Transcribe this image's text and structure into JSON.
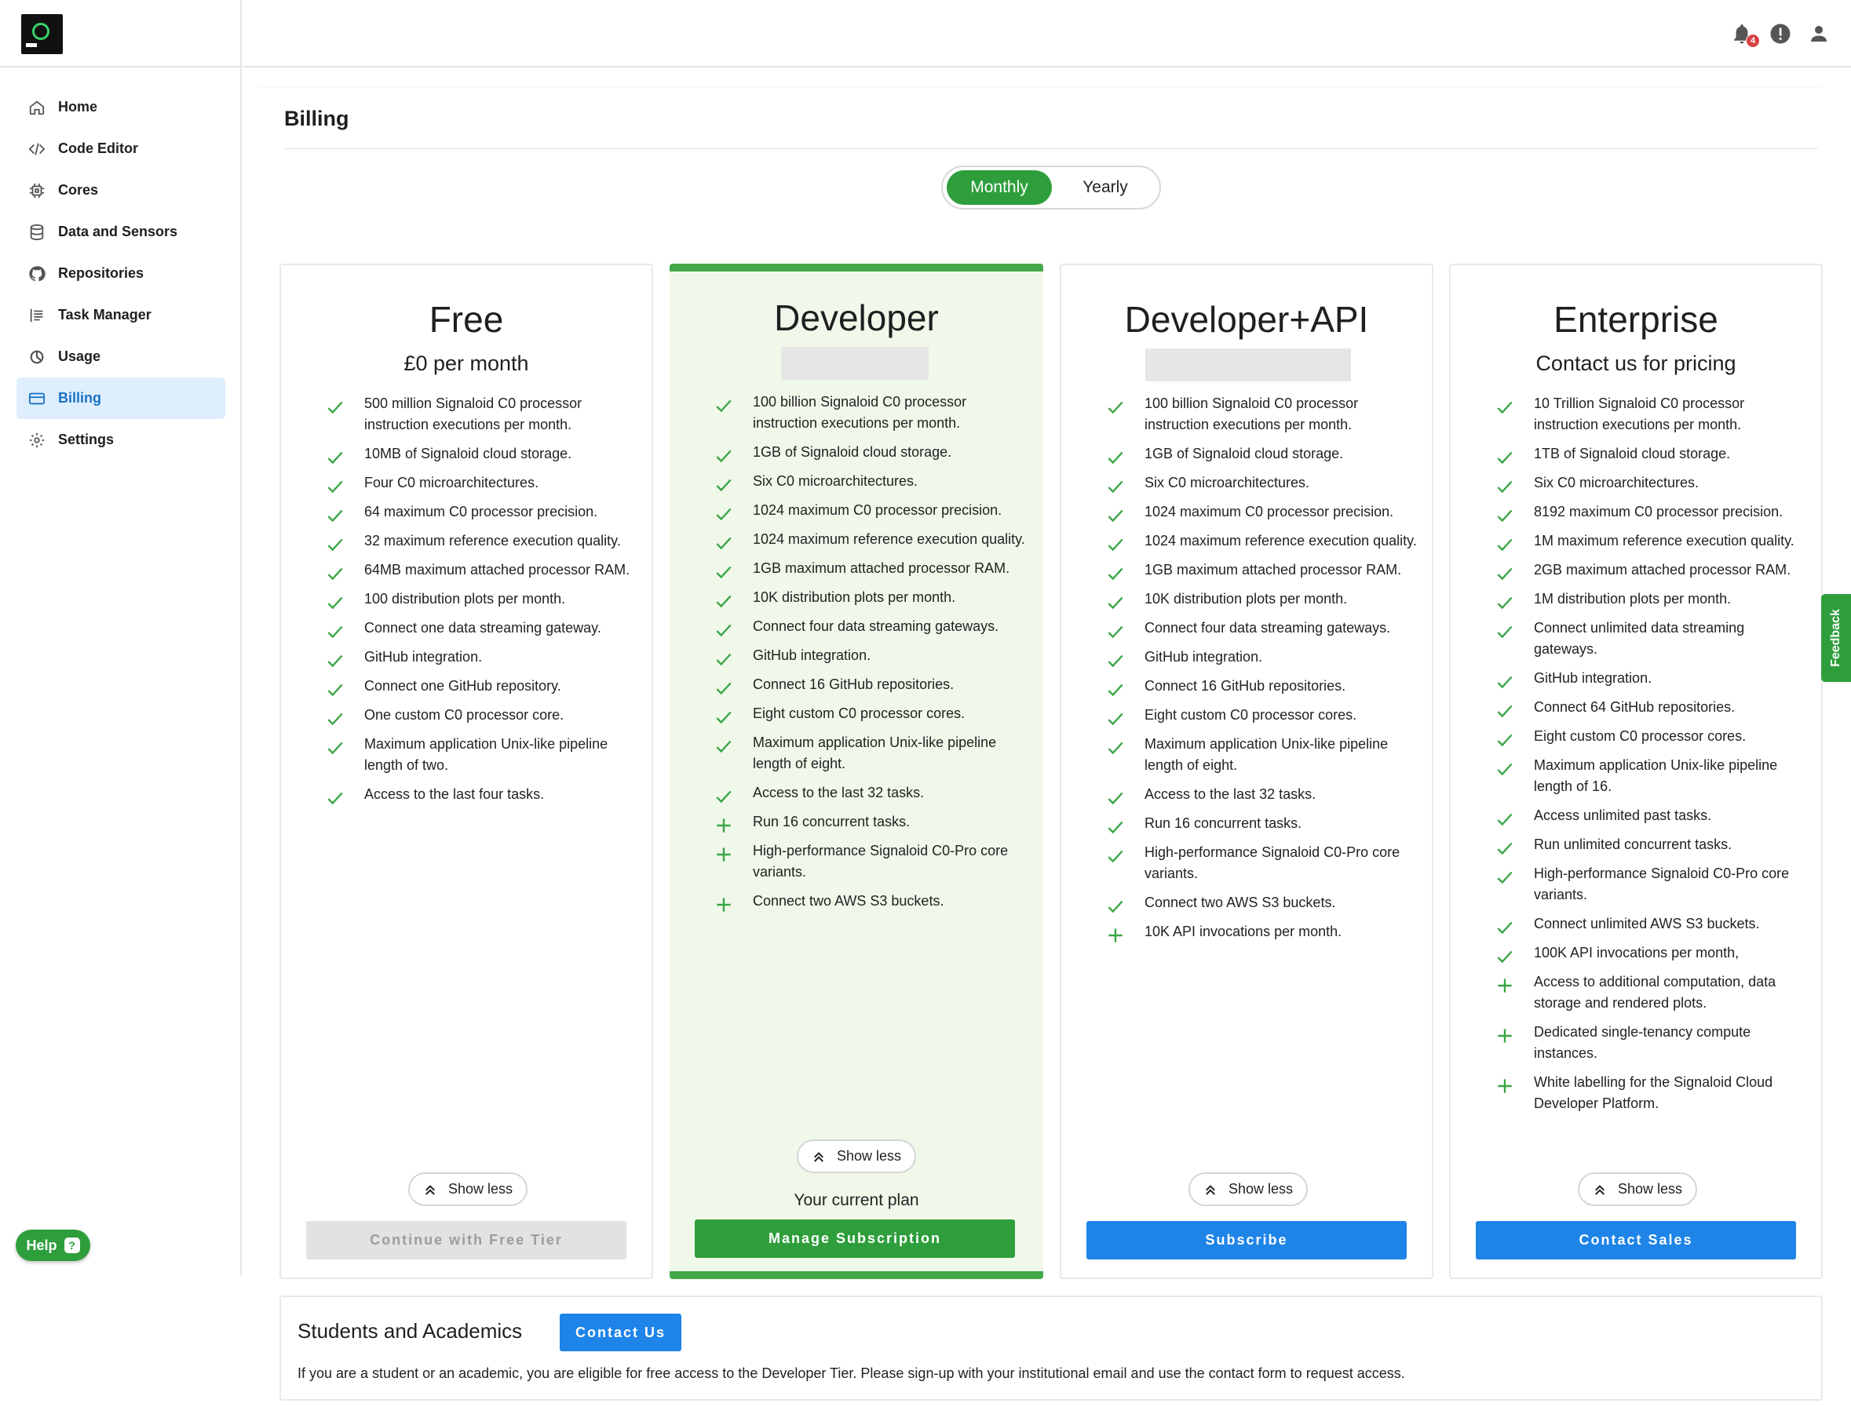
{
  "sidebar": {
    "items": [
      {
        "label": "Home",
        "icon": "home-icon"
      },
      {
        "label": "Code Editor",
        "icon": "code-icon"
      },
      {
        "label": "Cores",
        "icon": "chip-icon"
      },
      {
        "label": "Data and Sensors",
        "icon": "database-icon"
      },
      {
        "label": "Repositories",
        "icon": "github-icon"
      },
      {
        "label": "Task Manager",
        "icon": "list-icon"
      },
      {
        "label": "Usage",
        "icon": "pie-icon"
      },
      {
        "label": "Billing",
        "icon": "card-icon",
        "active": true
      },
      {
        "label": "Settings",
        "icon": "gear-icon"
      }
    ],
    "help_label": "Help"
  },
  "topbar": {
    "notification_count": "4"
  },
  "page": {
    "title": "Billing"
  },
  "toggle": {
    "monthly": "Monthly",
    "yearly": "Yearly",
    "selected": "Monthly"
  },
  "plans": [
    {
      "name": "Free",
      "price": "£0 per month",
      "features": [
        {
          "text": "500 million Signaloid C0 processor instruction executions per month.",
          "icon": "check"
        },
        {
          "text": "10MB of Signaloid cloud storage.",
          "icon": "check"
        },
        {
          "text": "Four C0 microarchitectures.",
          "icon": "check"
        },
        {
          "text": "64 maximum C0 processor precision.",
          "icon": "check"
        },
        {
          "text": "32 maximum reference execution quality.",
          "icon": "check"
        },
        {
          "text": "64MB maximum attached processor RAM.",
          "icon": "check"
        },
        {
          "text": "100 distribution plots per month.",
          "icon": "check"
        },
        {
          "text": "Connect one data streaming gateway.",
          "icon": "check"
        },
        {
          "text": "GitHub integration.",
          "icon": "check"
        },
        {
          "text": "Connect one GitHub repository.",
          "icon": "check"
        },
        {
          "text": "One custom C0 processor core.",
          "icon": "check"
        },
        {
          "text": "Maximum application Unix-like pipeline length of two.",
          "icon": "check"
        },
        {
          "text": "Access to the last four tasks.",
          "icon": "check"
        }
      ],
      "show_less": "Show less",
      "cta": "Continue with Free Tier"
    },
    {
      "name": "Developer",
      "price": "",
      "features": [
        {
          "text": "100 billion Signaloid C0 processor instruction executions per month.",
          "icon": "check"
        },
        {
          "text": "1GB of Signaloid cloud storage.",
          "icon": "check"
        },
        {
          "text": "Six C0 microarchitectures.",
          "icon": "check"
        },
        {
          "text": "1024 maximum C0 processor precision.",
          "icon": "check"
        },
        {
          "text": "1024 maximum reference execution quality.",
          "icon": "check"
        },
        {
          "text": "1GB maximum attached processor RAM.",
          "icon": "check"
        },
        {
          "text": "10K distribution plots per month.",
          "icon": "check"
        },
        {
          "text": "Connect four data streaming gateways.",
          "icon": "check"
        },
        {
          "text": "GitHub integration.",
          "icon": "check"
        },
        {
          "text": "Connect 16 GitHub repositories.",
          "icon": "check"
        },
        {
          "text": "Eight custom C0 processor cores.",
          "icon": "check"
        },
        {
          "text": "Maximum application Unix-like pipeline length of eight.",
          "icon": "check"
        },
        {
          "text": "Access to the last 32 tasks.",
          "icon": "check"
        },
        {
          "text": "Run 16 concurrent tasks.",
          "icon": "plus"
        },
        {
          "text": "High-performance Signaloid C0-Pro core variants.",
          "icon": "plus"
        },
        {
          "text": "Connect two AWS S3 buckets.",
          "icon": "plus"
        }
      ],
      "show_less": "Show less",
      "current_plan": "Your current plan",
      "cta": "Manage Subscription"
    },
    {
      "name": "Developer+API",
      "price": "",
      "features": [
        {
          "text": "100 billion Signaloid C0 processor instruction executions per month.",
          "icon": "check"
        },
        {
          "text": "1GB of Signaloid cloud storage.",
          "icon": "check"
        },
        {
          "text": "Six C0 microarchitectures.",
          "icon": "check"
        },
        {
          "text": "1024 maximum C0 processor precision.",
          "icon": "check"
        },
        {
          "text": "1024 maximum reference execution quality.",
          "icon": "check"
        },
        {
          "text": "1GB maximum attached processor RAM.",
          "icon": "check"
        },
        {
          "text": "10K distribution plots per month.",
          "icon": "check"
        },
        {
          "text": "Connect four data streaming gateways.",
          "icon": "check"
        },
        {
          "text": "GitHub integration.",
          "icon": "check"
        },
        {
          "text": "Connect 16 GitHub repositories.",
          "icon": "check"
        },
        {
          "text": "Eight custom C0 processor cores.",
          "icon": "check"
        },
        {
          "text": "Maximum application Unix-like pipeline length of eight.",
          "icon": "check"
        },
        {
          "text": "Access to the last 32 tasks.",
          "icon": "check"
        },
        {
          "text": "Run 16 concurrent tasks.",
          "icon": "check"
        },
        {
          "text": "High-performance Signaloid C0-Pro core variants.",
          "icon": "check"
        },
        {
          "text": "Connect two AWS S3 buckets.",
          "icon": "check"
        },
        {
          "text": "10K API invocations per month.",
          "icon": "plus"
        }
      ],
      "show_less": "Show less",
      "cta": "Subscribe"
    },
    {
      "name": "Enterprise",
      "price": "Contact us for pricing",
      "features": [
        {
          "text": "10 Trillion Signaloid C0 processor instruction executions per month.",
          "icon": "check"
        },
        {
          "text": "1TB of Signaloid cloud storage.",
          "icon": "check"
        },
        {
          "text": "Six C0 microarchitectures.",
          "icon": "check"
        },
        {
          "text": "8192 maximum C0 processor precision.",
          "icon": "check"
        },
        {
          "text": "1M maximum reference execution quality.",
          "icon": "check"
        },
        {
          "text": "2GB maximum attached processor RAM.",
          "icon": "check"
        },
        {
          "text": "1M distribution plots per month.",
          "icon": "check"
        },
        {
          "text": "Connect unlimited data streaming gateways.",
          "icon": "check"
        },
        {
          "text": "GitHub integration.",
          "icon": "check"
        },
        {
          "text": "Connect 64 GitHub repositories.",
          "icon": "check"
        },
        {
          "text": "Eight custom C0 processor cores.",
          "icon": "check"
        },
        {
          "text": "Maximum application Unix-like pipeline length of 16.",
          "icon": "check"
        },
        {
          "text": "Access unlimited past tasks.",
          "icon": "check"
        },
        {
          "text": "Run unlimited concurrent tasks.",
          "icon": "check"
        },
        {
          "text": "High-performance Signaloid C0-Pro core variants.",
          "icon": "check"
        },
        {
          "text": "Connect unlimited AWS S3 buckets.",
          "icon": "check"
        },
        {
          "text": "100K API invocations per month,",
          "icon": "check"
        },
        {
          "text": "Access to additional computation, data storage and rendered plots.",
          "icon": "plus"
        },
        {
          "text": "Dedicated single-tenancy compute instances.",
          "icon": "plus"
        },
        {
          "text": "White labelling for the Signaloid Cloud Developer Platform.",
          "icon": "plus"
        }
      ],
      "show_less": "Show less",
      "cta": "Contact Sales"
    }
  ],
  "feedback": "Feedback",
  "students": {
    "heading": "Students and Academics",
    "button": "Contact Us",
    "description": "If you are a student or an academic, you are eligible for free access to the Developer Tier. Please sign-up with your institutional email and use the contact form to request access."
  },
  "colors": {
    "brand_green": "#2e9e3c",
    "primary_blue": "#1e84e8",
    "active_nav_bg": "#dfeefc",
    "current_card_bg": "#f0f8ea"
  }
}
